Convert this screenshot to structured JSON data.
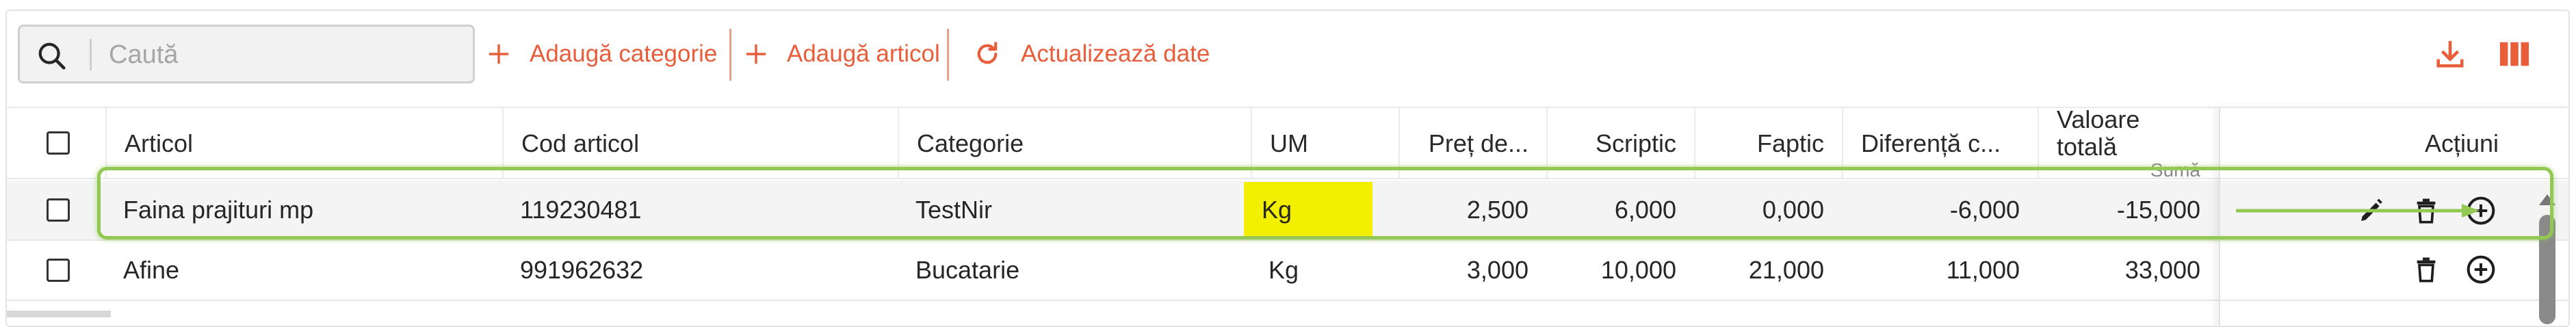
{
  "toolbar": {
    "search_placeholder": "Caută",
    "add_category": "Adaugă categorie",
    "add_article": "Adaugă articol",
    "refresh": "Actualizează date",
    "accent_color": "#e85d3a"
  },
  "table": {
    "columns": {
      "articol": "Articol",
      "cod": "Cod articol",
      "categorie": "Categorie",
      "um": "UM",
      "pret": "Preț de...",
      "scriptic": "Scriptic",
      "faptic": "Faptic",
      "diferenta": "Diferență c...",
      "valoare": "Valoare totală",
      "valoare_sub": "Sumă",
      "actiuni": "Acțiuni"
    },
    "rows": [
      {
        "articol": "Faina prajituri mp",
        "cod": "119230481",
        "categorie": "TestNir",
        "um": "Kg",
        "pret": "2,500",
        "scriptic": "6,000",
        "faptic": "0,000",
        "diferenta": "-6,000",
        "valoare": "-15,000"
      },
      {
        "articol": "Afine",
        "cod": "991962632",
        "categorie": "Bucatarie",
        "um": "Kg",
        "pret": "3,000",
        "scriptic": "10,000",
        "faptic": "21,000",
        "diferenta": "11,000",
        "valoare": "33,000"
      }
    ],
    "highlight_color": "#f2ef00",
    "annotation_color": "#93c952"
  },
  "icons": [
    "search-icon",
    "plus-icon",
    "refresh-icon",
    "download-icon",
    "columns-icon",
    "edit-icon",
    "trash-icon",
    "add-circle-icon"
  ]
}
